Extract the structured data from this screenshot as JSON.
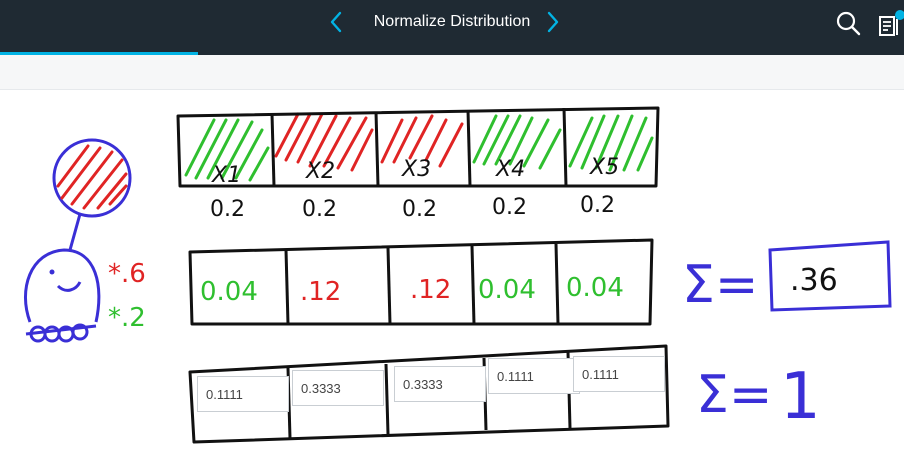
{
  "header": {
    "title": "Normalize Distribution"
  },
  "drawing": {
    "cells": [
      "X1",
      "X2",
      "X3",
      "X4",
      "X5"
    ],
    "prior": [
      "0.2",
      "0.2",
      "0.2",
      "0.2",
      "0.2"
    ],
    "multipliers": {
      "hit": "*.6",
      "miss": "*.2"
    },
    "products": [
      "0.04",
      ".12",
      ".12",
      "0.04",
      "0.04"
    ],
    "sum_label": "Σ=",
    "sum_value": ".36",
    "normalized_sum_label": "Σ=",
    "normalized_sum_value": "1"
  },
  "answers": [
    "0.1111",
    "0.3333",
    "0.3333",
    "0.1111",
    "0.1111"
  ],
  "colors": {
    "hit": "#2fbf2f",
    "miss": "#e02424",
    "ink": "#111111",
    "sum": "#3a2fd6",
    "accent": "#02b3e4"
  }
}
